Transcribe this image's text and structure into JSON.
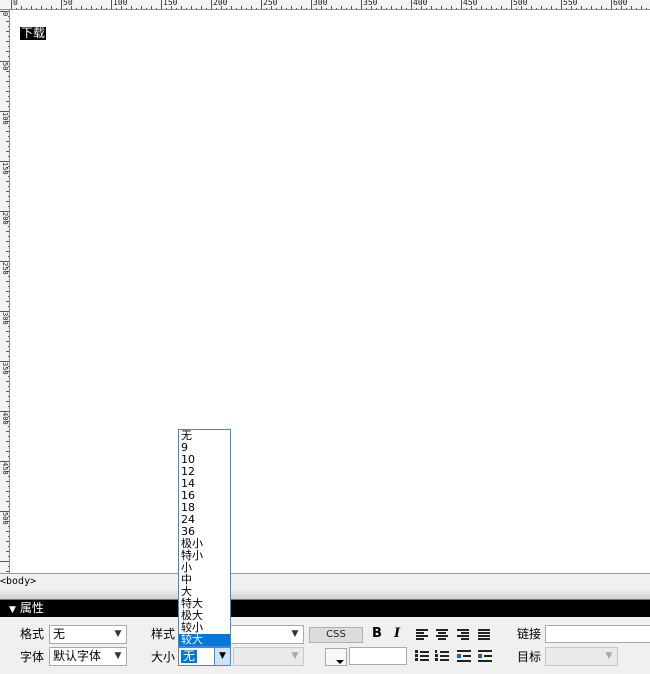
{
  "ruler": {
    "top_labels": [
      "0",
      "50",
      "100",
      "150",
      "200",
      "250",
      "300",
      "350",
      "400",
      "450",
      "500",
      "550",
      "600"
    ],
    "left_labels": [
      "0",
      "50",
      "100",
      "150",
      "200",
      "250",
      "300",
      "350",
      "400",
      "450",
      "500"
    ]
  },
  "canvas": {
    "selected_text": "下载"
  },
  "tag_selector": {
    "tag": "<body>"
  },
  "properties": {
    "title": "属性",
    "labels": {
      "format": "格式",
      "style": "样式",
      "link": "链接",
      "font": "字体",
      "size": "大小",
      "target": "目标"
    },
    "format_value": "无",
    "font_value": "默认字体",
    "style_value": "",
    "size_value": "无",
    "css_label": "CSS",
    "bold_label": "B",
    "italic_label": "I"
  },
  "size_dropdown": {
    "options": [
      "无",
      "9",
      "10",
      "12",
      "14",
      "16",
      "18",
      "24",
      "36",
      "极小",
      "特小",
      "小",
      "中",
      "大",
      "特大",
      "极大",
      "较小",
      "较大"
    ],
    "selected": "较大"
  },
  "colors": {
    "selection": "#0078d7",
    "header_bg": "#000000",
    "panel_bg": "#f0f0f0"
  }
}
